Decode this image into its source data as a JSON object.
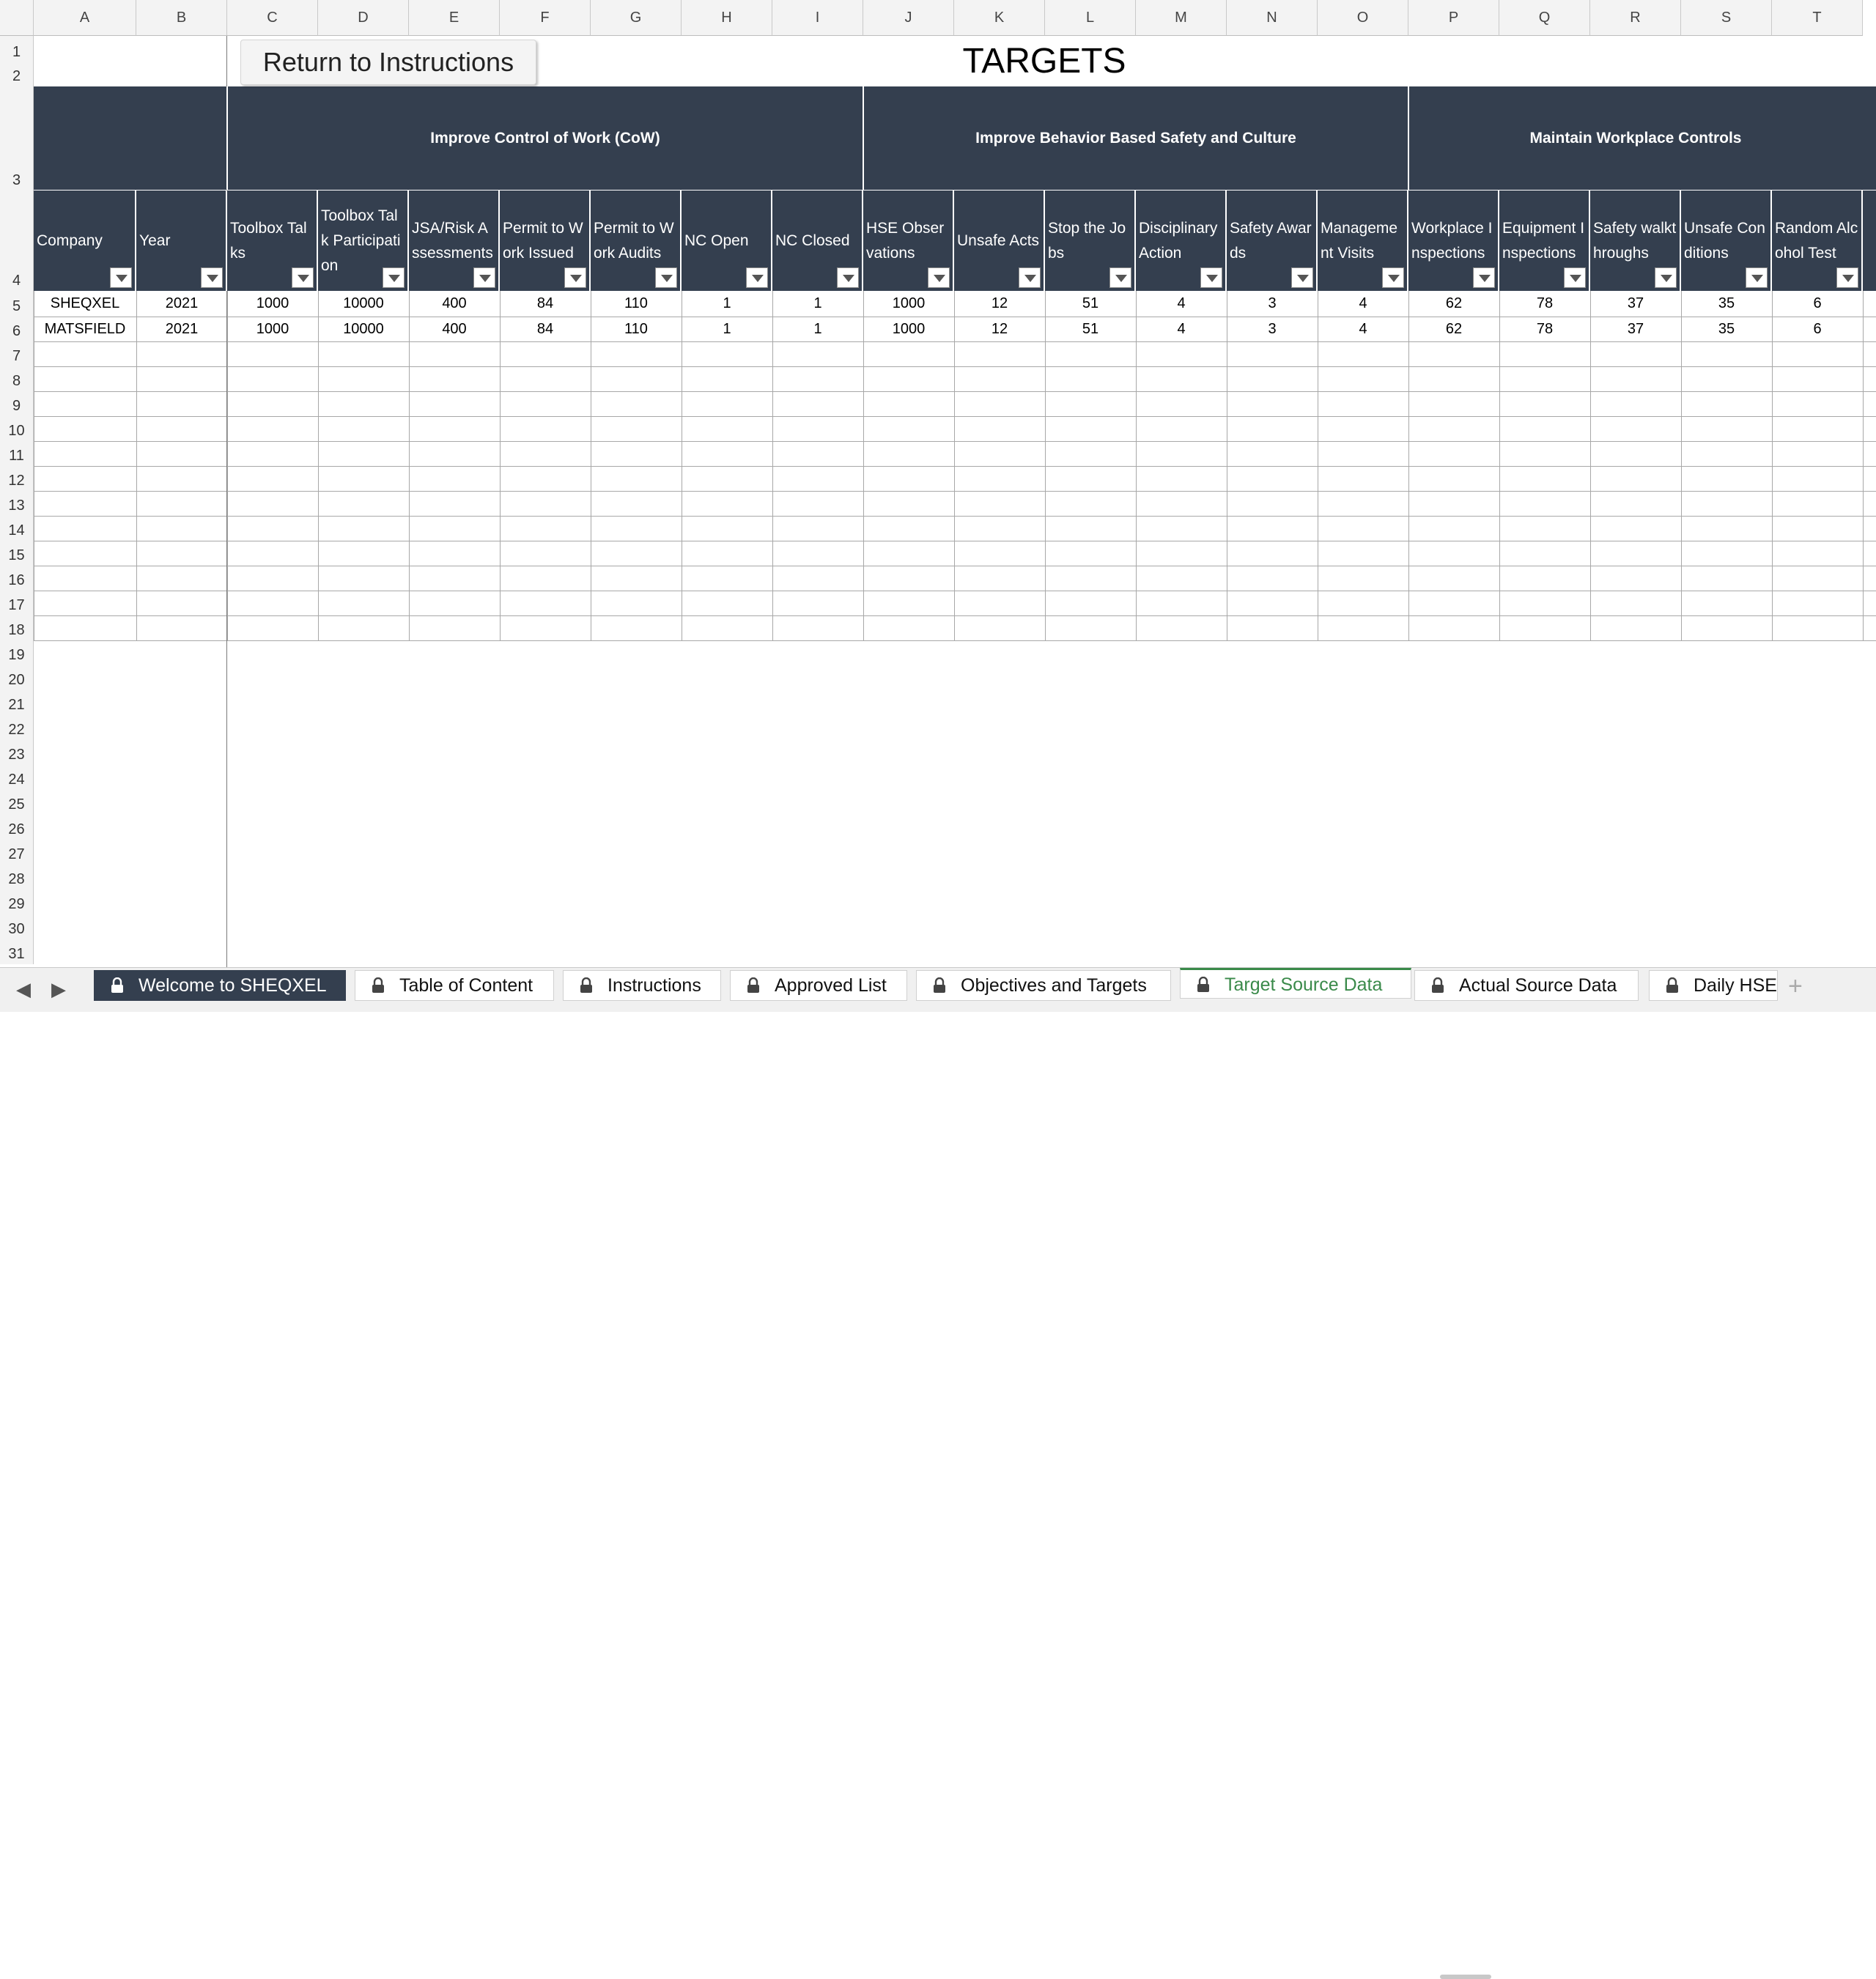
{
  "columns": [
    "A",
    "B",
    "C",
    "D",
    "E",
    "F",
    "G",
    "H",
    "I",
    "J",
    "K",
    "L",
    "M",
    "N",
    "O",
    "P",
    "Q",
    "R",
    "S",
    "T"
  ],
  "rows": [
    "1",
    "2",
    "3",
    "4",
    "5",
    "6",
    "7",
    "8",
    "9",
    "10",
    "11",
    "12",
    "13",
    "14",
    "15",
    "16",
    "17",
    "18",
    "19",
    "20",
    "21",
    "22",
    "23",
    "24",
    "25",
    "26",
    "27",
    "28",
    "29",
    "30",
    "31"
  ],
  "return_button": "Return to Instructions",
  "title": "TARGETS",
  "groups": [
    {
      "label": "Improve Control of Work (CoW)"
    },
    {
      "label": "Improve Behavior Based Safety and Culture"
    },
    {
      "label": "Maintain Workplace Controls"
    }
  ],
  "headers": [
    "Company",
    "Year",
    "Toolbox Talks",
    "Toolbox Talk Participation",
    "JSA/Risk Assessments",
    "Permit to Work Issued",
    "Permit to Work Audits",
    "NC Open",
    "NC Closed",
    "HSE Observations",
    "Unsafe Acts",
    "Stop  the Jobs",
    "Disciplinary Action",
    "Safety Awards",
    "Management Visits",
    "Workplace Inspections",
    "Equipment Inspections",
    "Safety walkthroughs",
    "Unsafe Conditions",
    "Random Alcohol Test"
  ],
  "data_rows": [
    [
      "SHEQXEL",
      "2021",
      "1000",
      "10000",
      "400",
      "84",
      "110",
      "1",
      "1",
      "1000",
      "12",
      "51",
      "4",
      "3",
      "4",
      "62",
      "78",
      "37",
      "35",
      "6"
    ],
    [
      "MATSFIELD",
      "2021",
      "1000",
      "10000",
      "400",
      "84",
      "110",
      "1",
      "1",
      "1000",
      "12",
      "51",
      "4",
      "3",
      "4",
      "62",
      "78",
      "37",
      "35",
      "6"
    ]
  ],
  "tabs": [
    {
      "label": "Welcome to SHEQXEL",
      "state": "dark"
    },
    {
      "label": "Table of Content",
      "state": "normal"
    },
    {
      "label": "Instructions",
      "state": "normal"
    },
    {
      "label": "Approved List",
      "state": "normal"
    },
    {
      "label": "Objectives and Targets",
      "state": "normal"
    },
    {
      "label": "Target Source Data",
      "state": "active"
    },
    {
      "label": "Actual Source Data",
      "state": "normal"
    },
    {
      "label": "Daily HSE",
      "state": "normal"
    }
  ],
  "add_tab": "+",
  "colors": {
    "header_fill": "#343f4f",
    "active_tab": "#3a8a4a"
  }
}
